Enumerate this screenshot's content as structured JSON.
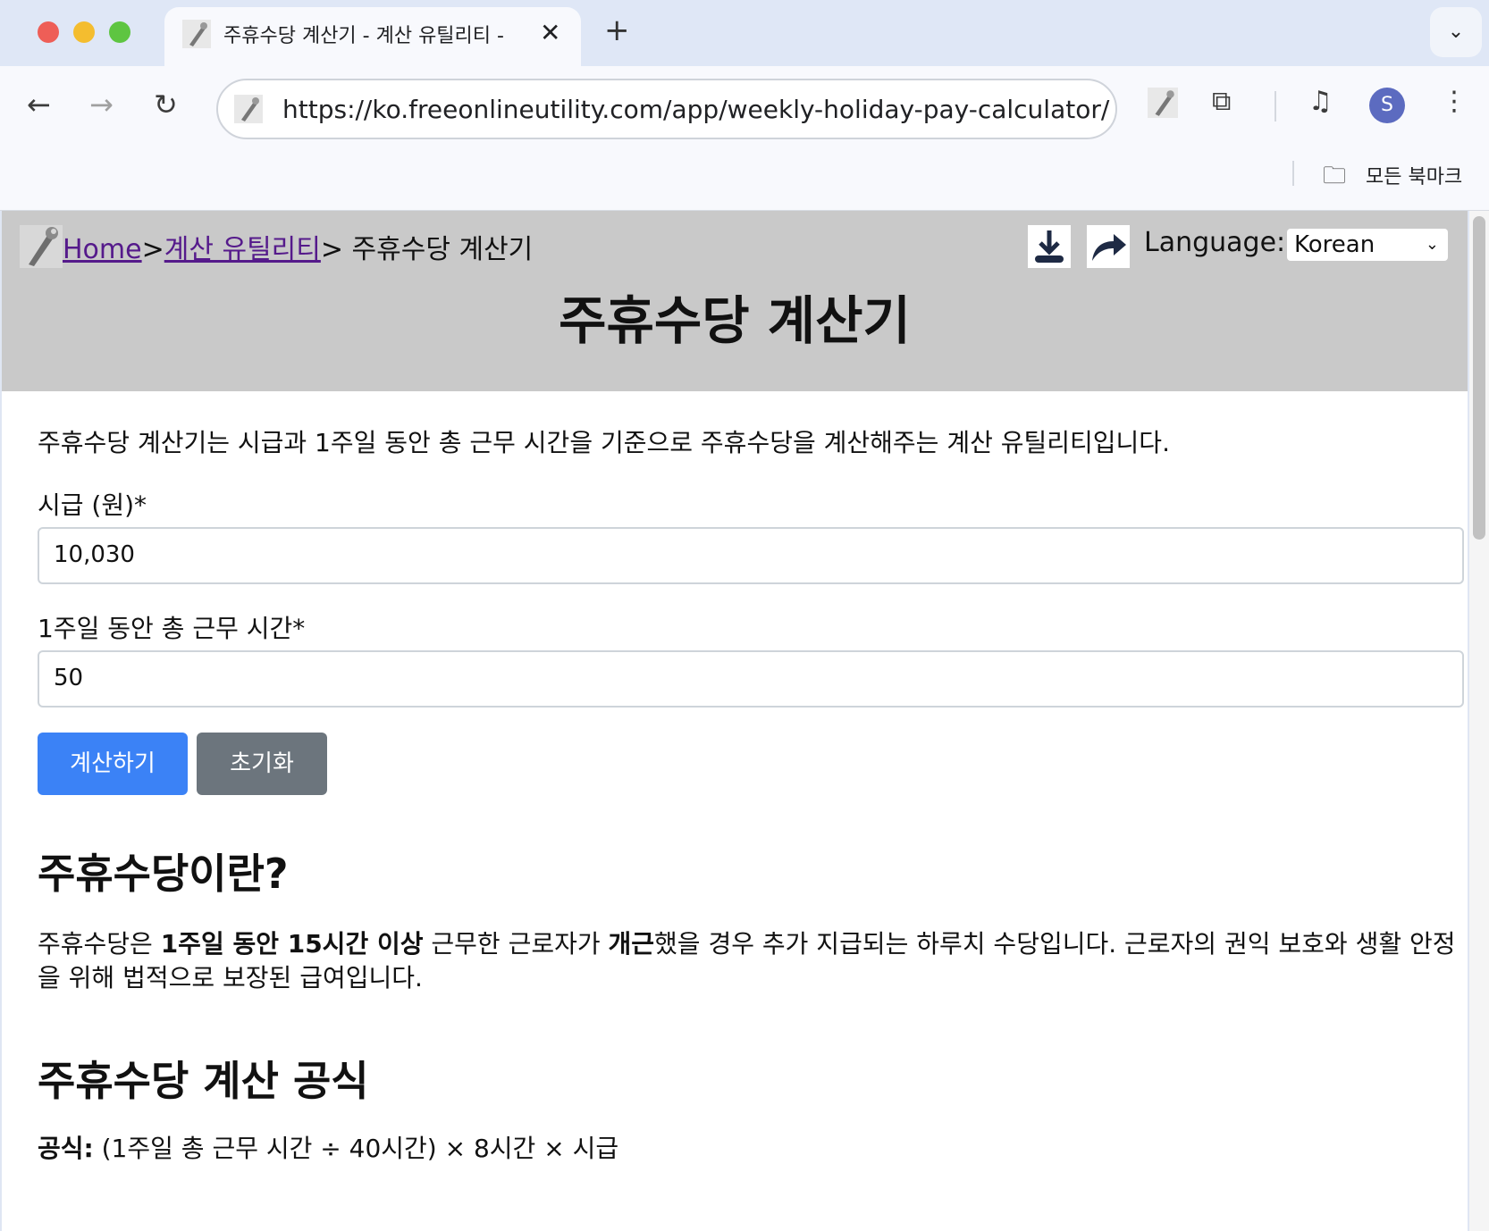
{
  "browser": {
    "tab_title": "주휴수당 계산기 - 계산 유틸리티 -",
    "tab_close": "✕",
    "new_tab": "+",
    "tab_menu": "⌄",
    "url": "https://ko.freeonlineutility.com/app/weekly-holiday-pay-calculator/",
    "avatar_letter": "S",
    "bookmarks_label": "모든 북마크"
  },
  "header": {
    "breadcrumb_home": "Home",
    "breadcrumb_sep1": ">",
    "breadcrumb_category": "계산 유틸리티",
    "breadcrumb_current": "> 주휴수당 계산기",
    "language_label": "Language:",
    "language_value": "Korean",
    "title": "주휴수당 계산기"
  },
  "form": {
    "intro": "주휴수당 계산기는 시급과 1주일 동안 총 근무 시간을 기준으로 주휴수당을 계산해주는 계산 유틸리티입니다.",
    "wage_label": "시급 (원)*",
    "wage_value": "10,030",
    "hours_label": "1주일 동안 총 근무 시간*",
    "hours_value": "50",
    "calc_button": "계산하기",
    "reset_button": "초기화"
  },
  "section_what": {
    "heading": "주휴수당이란?",
    "p_1": "주휴수당은 ",
    "p_bold_1": "1주일 동안 15시간 이상",
    "p_2": " 근무한 근로자가 ",
    "p_bold_2": "개근",
    "p_3": "했을 경우 추가 지급되는 하루치 수당입니다. 근로자의 권익 보호와 생활 안정을 위해 법적으로 보장된 급여입니다."
  },
  "section_formula": {
    "heading": "주휴수당 계산 공식",
    "label": "공식:",
    "text": " (1주일 총 근무 시간 ÷ 40시간) × 8시간 × 시급"
  },
  "colors": {
    "calc_button": "#3b82f6",
    "reset_button": "#6c757d",
    "header_bg": "#c9c9c9",
    "link": "#551a8b"
  }
}
